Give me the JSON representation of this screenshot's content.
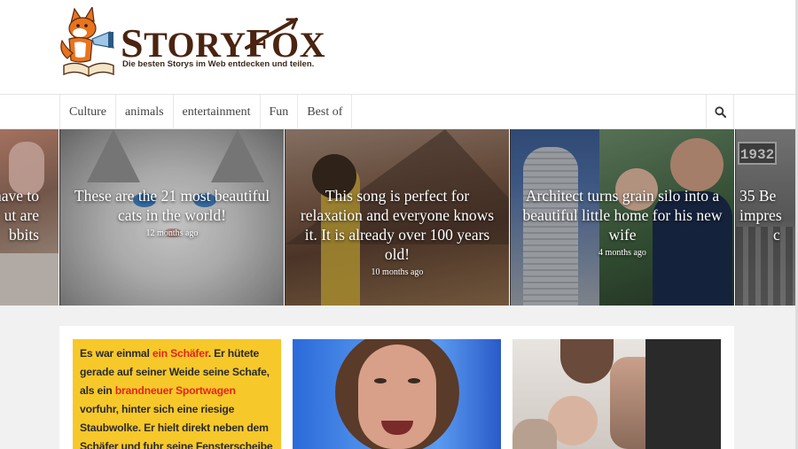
{
  "brand": {
    "name_first": "S",
    "name_rest1": "TORY",
    "name_mid": "F",
    "name_rest2": "OX",
    "tagline": "Die besten Storys im Web entdecken und teilen."
  },
  "nav": {
    "items": [
      "Culture",
      "animals",
      "entertainment",
      "Fun",
      "Best of"
    ],
    "search_icon": "search-icon"
  },
  "slider": {
    "slides": [
      {
        "title": "…have to …ut are …bbits",
        "line1": "have to",
        "line2": "ut are",
        "line3": "bbits"
      },
      {
        "title": "These are the 21 most beautiful cats in the world!",
        "time": "12 months ago"
      },
      {
        "title": "This song is perfect for relaxation and everyone knows it. It is already over 100 years old!",
        "time": "10 months ago"
      },
      {
        "title": "Architect turns grain silo into a beautiful little home for his new wife",
        "time": "4 months ago"
      },
      {
        "line1": "35 Be",
        "line2": "impres",
        "line3": "c",
        "sign": "1932"
      }
    ]
  },
  "cards": {
    "story_text": {
      "p1": "Es war einmal ",
      "p1_red": "ein Schäfer",
      "p2": ". Er hütete gerade auf seiner Weide seine Schafe, als ein ",
      "p2_red": "brandneuer Sportwagen",
      "p3": " vorfuhr, hinter sich eine riesige Staubwolke. Er hielt direkt neben dem Schäfer und fuhr seine Fensterscheibe herunter."
    }
  },
  "colors": {
    "accent_yellow": "#f7c82a",
    "accent_red": "#e4241b",
    "brand_brown": "#4a2410",
    "fox_orange": "#e8741e"
  }
}
